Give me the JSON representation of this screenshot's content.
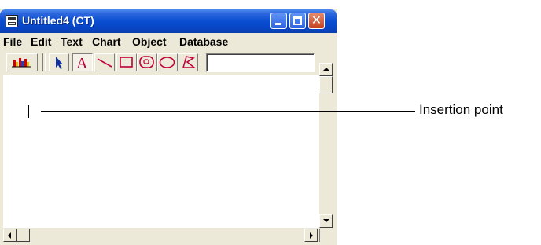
{
  "window": {
    "title": "Untitled4 (CT)"
  },
  "menu": [
    "File",
    "Edit",
    "Text",
    "Chart",
    "Object",
    "Database"
  ],
  "toolbar": {
    "tools": [
      "chart-tool",
      "selection-arrow",
      "text-tool",
      "line-tool",
      "rectangle-tool",
      "rounded-rectangle-tool",
      "oval-tool",
      "polygon-tool"
    ],
    "selected_tool": "text-tool",
    "input_value": ""
  },
  "annotation": {
    "label": "Insertion point"
  },
  "colors": {
    "titlebar": "#0a4ed2",
    "close_button": "#c3401f",
    "tool_icon": "#c0003c",
    "chart_bars": [
      "#d40000",
      "#e8c000",
      "#2040c0"
    ]
  }
}
